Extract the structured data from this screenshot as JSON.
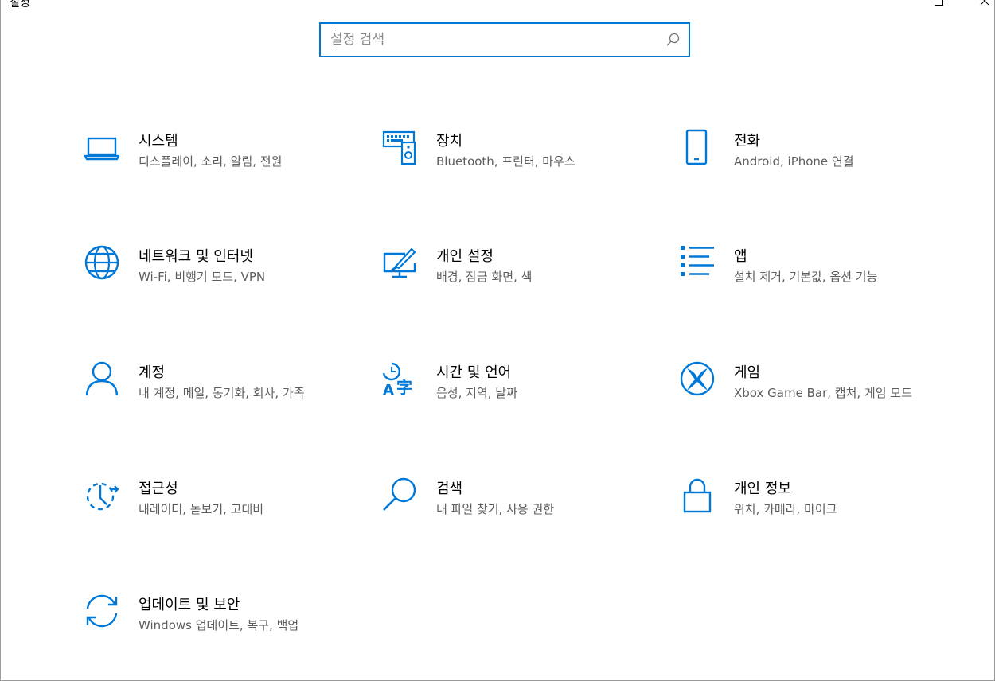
{
  "window": {
    "title": "설정",
    "controls": [
      "minimize-icon",
      "maximize-icon",
      "close-icon"
    ]
  },
  "search": {
    "placeholder": "설정 검색",
    "icon": "search-icon"
  },
  "accent_color": "#0078d7",
  "tiles": [
    {
      "title": "시스템",
      "desc": "디스플레이, 소리, 알림, 전원",
      "icon": "laptop-icon"
    },
    {
      "title": "장치",
      "desc": "Bluetooth, 프린터, 마우스",
      "icon": "devices-icon"
    },
    {
      "title": "전화",
      "desc": "Android, iPhone 연결",
      "icon": "phone-icon"
    },
    {
      "title": "네트워크 및 인터넷",
      "desc": "Wi-Fi, 비행기 모드, VPN",
      "icon": "globe-icon"
    },
    {
      "title": "개인 설정",
      "desc": "배경, 잠금 화면, 색",
      "icon": "personalization-icon"
    },
    {
      "title": "앱",
      "desc": "설치 제거, 기본값, 옵션 기능",
      "icon": "apps-list-icon"
    },
    {
      "title": "계정",
      "desc": "내 계정, 메일, 동기화, 회사, 가족",
      "icon": "person-icon"
    },
    {
      "title": "시간 및 언어",
      "desc": "음성, 지역, 날짜",
      "icon": "time-language-icon"
    },
    {
      "title": "게임",
      "desc": "Xbox Game Bar, 캡처, 게임 모드",
      "icon": "xbox-icon"
    },
    {
      "title": "접근성",
      "desc": "내레이터, 돋보기, 고대비",
      "icon": "ease-of-access-icon"
    },
    {
      "title": "검색",
      "desc": "내 파일 찾기, 사용 권한",
      "icon": "search-magnifier-icon"
    },
    {
      "title": "개인 정보",
      "desc": "위치, 카메라, 마이크",
      "icon": "lock-icon"
    },
    {
      "title": "업데이트 및 보안",
      "desc": "Windows 업데이트, 복구, 백업",
      "icon": "sync-icon"
    }
  ]
}
